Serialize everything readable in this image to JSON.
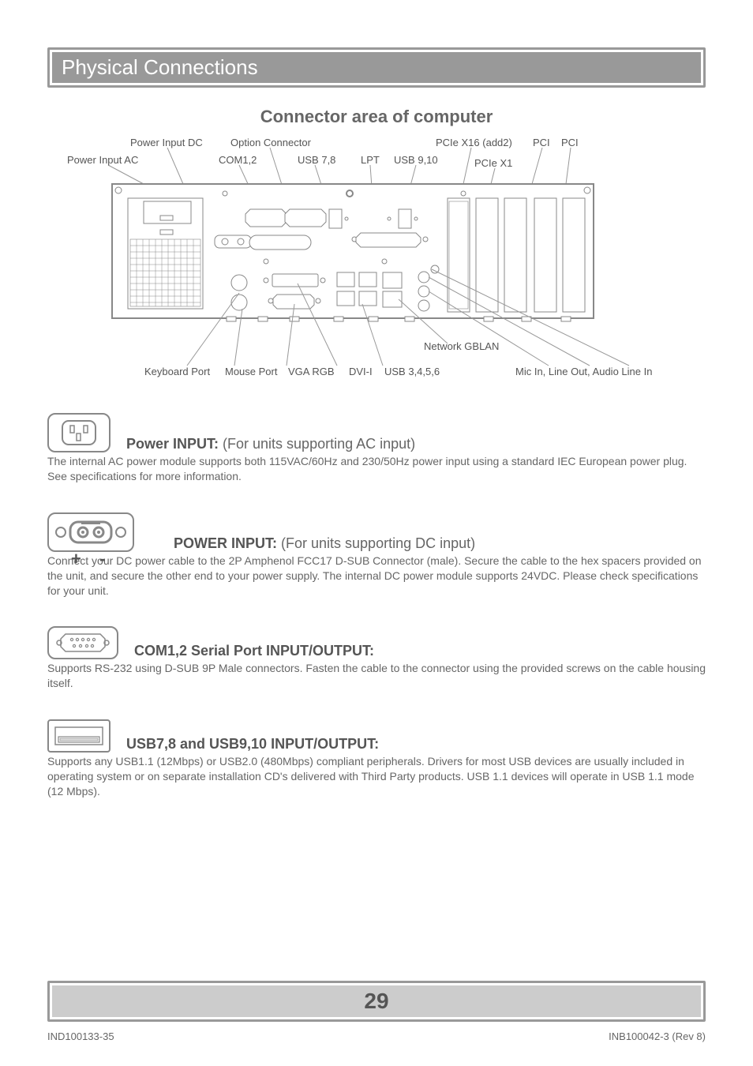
{
  "header": {
    "title": "Physical Connections"
  },
  "diagram": {
    "subtitle": "Connector area of computer",
    "labels_top": {
      "power_input_dc": "Power Input DC",
      "option_connector": "Option Connector",
      "pcie_x16": "PCIe X16 (add2)",
      "pci1": "PCI",
      "pci2": "PCI",
      "power_input_ac": "Power Input AC",
      "com12": "COM1,2",
      "usb78": "USB 7,8",
      "lpt": "LPT",
      "usb910": "USB 9,10",
      "pcie_x1": "PCIe X1"
    },
    "labels_bottom": {
      "keyboard": "Keyboard Port",
      "mouse": "Mouse Port",
      "vga": "VGA RGB",
      "dvi": "DVI-I",
      "usb3456": "USB 3,4,5,6",
      "network": "Network GBLAN",
      "audio": "Mic In, Line Out, Audio Line In"
    }
  },
  "sections": {
    "ac": {
      "heading_bold": "Power INPUT:",
      "heading_rest": " (For units supporting AC input)",
      "body": "The internal AC power module supports both 115VAC/60Hz and 230/50Hz power input using a standard IEC European power plug. See specifications for more information."
    },
    "dc": {
      "heading_bold": "POWER INPUT:",
      "heading_rest": " (For units supporting DC input)",
      "body": "Connect your DC power cable to the 2P Amphenol FCC17 D-SUB Connector (male). Secure the cable to the hex spacers provided on the unit, and secure the other end to your power supply. The internal DC power module supports 24VDC. Please check specifications for your unit.",
      "plus": "+",
      "minus": "-"
    },
    "com": {
      "heading_bold": "COM1,2 Serial Port INPUT/OUTPUT:",
      "heading_rest": "",
      "body": "Supports RS-232 using D-SUB 9P Male connectors. Fasten the cable to the connector using the provided screws on the cable housing itself."
    },
    "usb": {
      "heading_bold": "USB7,8 and USB9,10 INPUT/OUTPUT:",
      "heading_rest": "",
      "body": "Supports any USB1.1 (12Mbps) or USB2.0 (480Mbps) compliant peripherals. Drivers for most USB devices are usually included in operating system or on separate installation CD's delivered with Third Party products. USB 1.1 devices will operate in USB 1.1 mode (12 Mbps)."
    }
  },
  "footer": {
    "left": "IND100133-35",
    "right": "INB100042-3 (Rev 8)",
    "page_number": "29"
  }
}
